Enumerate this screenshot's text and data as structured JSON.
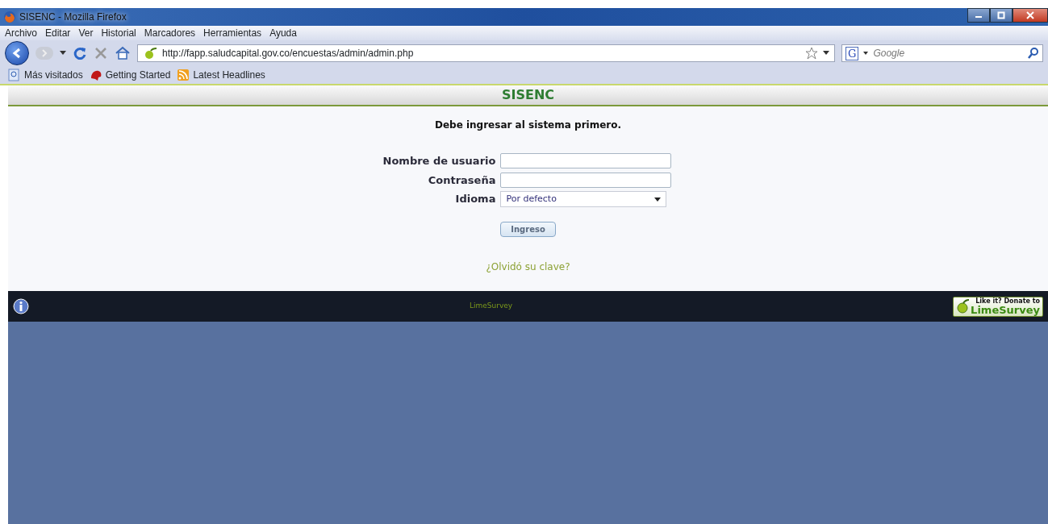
{
  "window": {
    "title": "SISENC - Mozilla Firefox"
  },
  "menu": [
    "Archivo",
    "Editar",
    "Ver",
    "Historial",
    "Marcadores",
    "Herramientas",
    "Ayuda"
  ],
  "address_bar": {
    "value": "http://fapp.saludcapital.gov.co/encuestas/admin/admin.php"
  },
  "search": {
    "engine_badge": "G",
    "placeholder": "Google"
  },
  "bookmarks": [
    {
      "label": "Más visitados",
      "kind": "search"
    },
    {
      "label": "Getting Started",
      "kind": "start"
    },
    {
      "label": "Latest Headlines",
      "kind": "feed"
    }
  ],
  "page": {
    "header": "SISENC",
    "message": "Debe ingresar al sistema primero.",
    "fields": [
      {
        "label": "Nombre de usuario",
        "kind": "text"
      },
      {
        "label": "Contraseña",
        "kind": "password"
      },
      {
        "label": "Idioma",
        "kind": "select",
        "value": "Por defecto"
      }
    ],
    "submit": "Ingreso",
    "forgot_link": "¿Olvidó su clave?",
    "footer": {
      "text": "LimeSurvey",
      "donate_top": "Like it? Donate to",
      "donate_bottom": "LimeSurvey"
    }
  }
}
